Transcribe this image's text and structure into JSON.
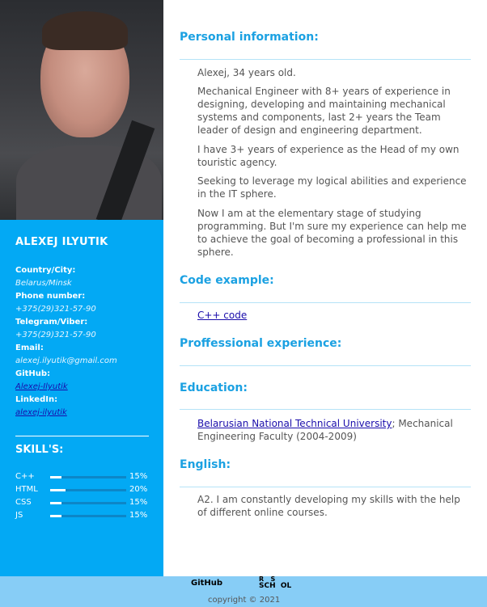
{
  "profile": {
    "name": "ALEXEJ ILYUTIK",
    "country_label": "Country/City:",
    "country_value": "Belarus/Minsk",
    "phone_label": "Phone number:",
    "phone_value": "+375(29)321-57-90",
    "telegram_label": "Telegram/Viber:",
    "telegram_value": "+375(29)321-57-90",
    "email_label": "Email:",
    "email_value": "alexej.ilyutik@gmail.com",
    "github_label": "GitHub:",
    "github_value": "Alexej-Ilyutik",
    "linkedin_label": "LinkedIn:",
    "linkedin_value": "alexej-ilyutik"
  },
  "skills": {
    "title": "SKILL'S:",
    "items": [
      {
        "label": "C++",
        "percent_text": "15%",
        "level": 0.15
      },
      {
        "label": "HTML",
        "percent_text": "20%",
        "level": 0.2
      },
      {
        "label": "CSS",
        "percent_text": "15%",
        "level": 0.15
      },
      {
        "label": "JS",
        "percent_text": "15%",
        "level": 0.15
      }
    ]
  },
  "personal": {
    "title": "Personal information:",
    "p1": "Alexej, 34 years old.",
    "p2": "Mechanical Engineer with 8+ years of experience in designing, developing and maintaining mechanical systems and components, last 2+ years the Team leader of design and engineering department.",
    "p3": "I have 3+ years of experience as the Head of my own touristic agency.",
    "p4": "Seeking to leverage my logical abilities and experience in the IT sphere.",
    "p5": "Now I am at the elementary stage of studying programming. But I'm sure my experience can help me to achieve the goal of becoming a professional in this sphere."
  },
  "code": {
    "title": "Code example:",
    "link": "C++ code"
  },
  "experience": {
    "title": "Proffessional experience:"
  },
  "education": {
    "title": "Education:",
    "link": "Belarusian National Technical University",
    "rest": "; Mechanical Engineering Faculty (2004-2009)"
  },
  "english": {
    "title": "English:",
    "text": "A2. I am constantly developing my skills with the help of different online courses."
  },
  "footer": {
    "github": "GitHub",
    "rs_line1": "R   S",
    "rs_line2": "SCH  OL",
    "copyright": "copyright © 2021"
  },
  "colors": {
    "sidebar": "#03a9f4",
    "heading": "#1ba1e2",
    "footer": "#87cdf6"
  }
}
